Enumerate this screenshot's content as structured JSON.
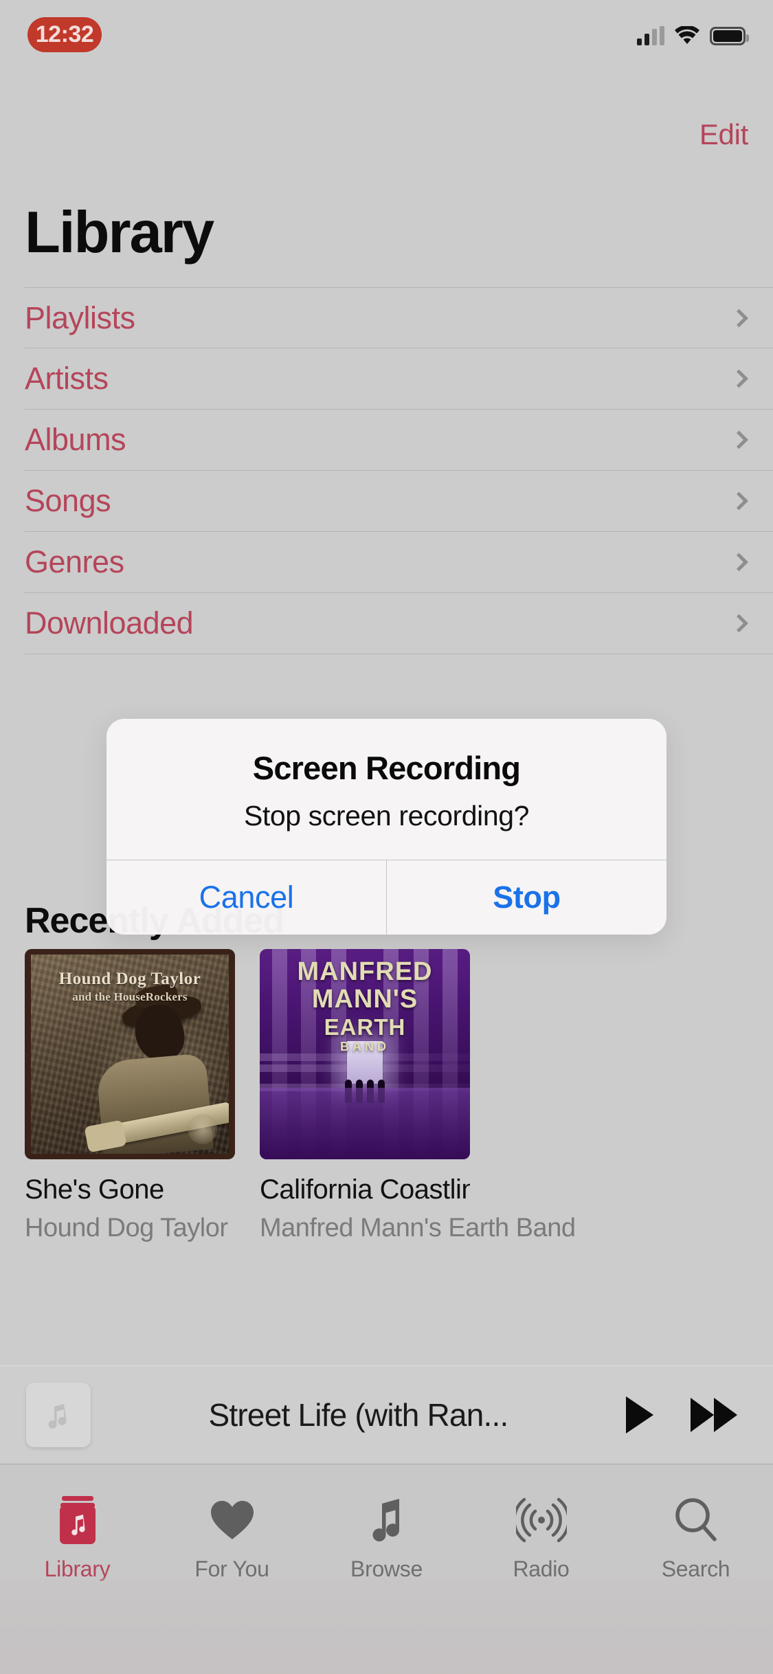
{
  "status_bar": {
    "time": "12:32",
    "recording_pill_color": "#c0392b",
    "signal_icon": "cellular-signal-icon",
    "wifi_icon": "wifi-icon",
    "battery_icon": "battery-icon"
  },
  "nav": {
    "edit_label": "Edit",
    "title": "Library"
  },
  "library_rows": [
    {
      "label": "Playlists"
    },
    {
      "label": "Artists"
    },
    {
      "label": "Albums"
    },
    {
      "label": "Songs"
    },
    {
      "label": "Genres"
    },
    {
      "label": "Downloaded"
    }
  ],
  "recently_added": {
    "heading": "Recently Added",
    "albums": [
      {
        "title": "She's Gone",
        "artist": "Hound Dog Taylor",
        "art_line1": "Hound Dog Taylor",
        "art_line2": "and the HouseRockers"
      },
      {
        "title": "California Coastline",
        "artist": "Manfred Mann's Earth Band",
        "art_line1": "MANFRED",
        "art_line2": "MANN'S",
        "art_line3": "EARTH",
        "art_line4": "BAND"
      }
    ]
  },
  "mini_player": {
    "artwork_icon": "music-note-icon",
    "now_playing": "Street Life (with Ran...",
    "play_icon": "play-icon",
    "forward_icon": "fast-forward-icon"
  },
  "tab_bar": {
    "tabs": [
      {
        "label": "Library",
        "icon": "library-icon",
        "active": true
      },
      {
        "label": "For You",
        "icon": "heart-icon",
        "active": false
      },
      {
        "label": "Browse",
        "icon": "music-note-icon",
        "active": false
      },
      {
        "label": "Radio",
        "icon": "radio-waves-icon",
        "active": false
      },
      {
        "label": "Search",
        "icon": "search-icon",
        "active": false
      }
    ],
    "active_color": "#b5455a",
    "inactive_color": "#6f6f6f"
  },
  "alert": {
    "title": "Screen Recording",
    "message": "Stop screen recording?",
    "cancel_label": "Cancel",
    "confirm_label": "Stop",
    "button_color": "#1a72e8"
  }
}
